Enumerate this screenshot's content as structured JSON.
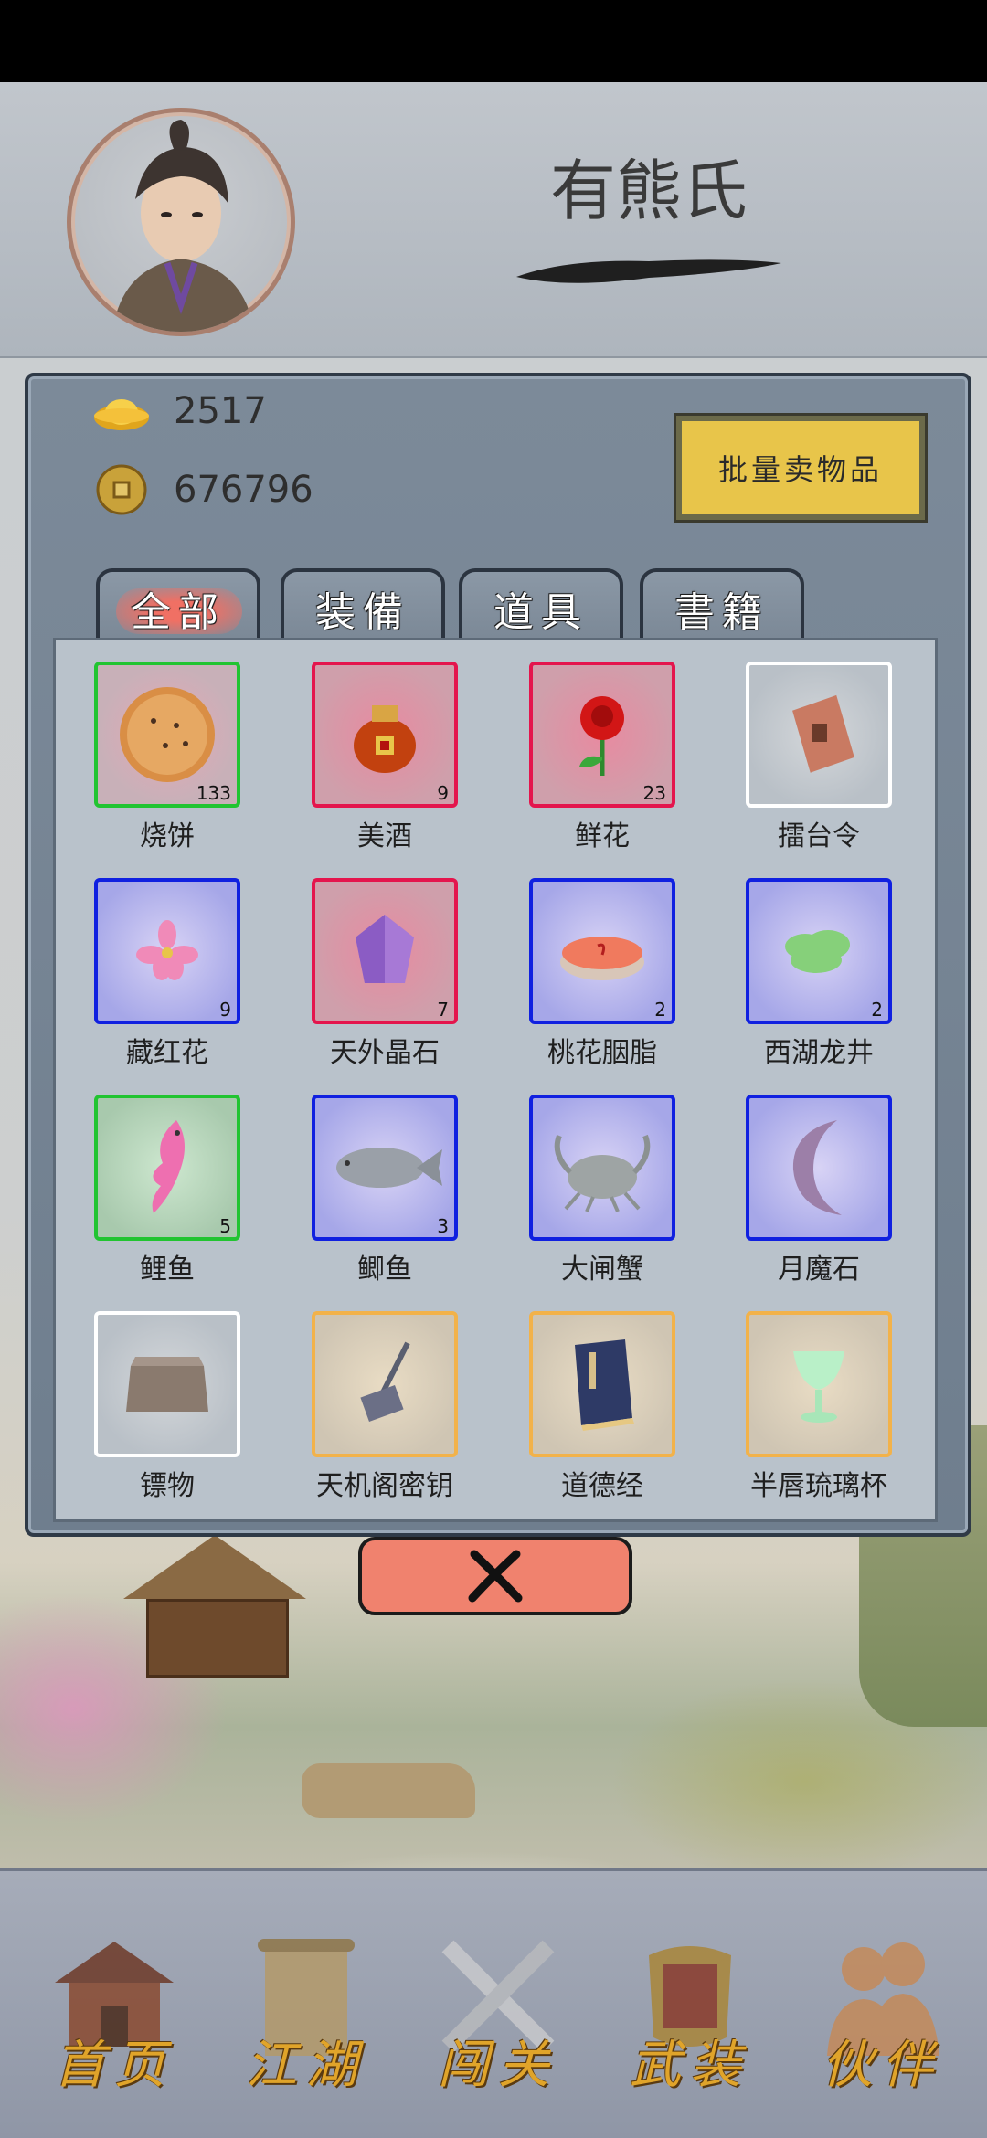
{
  "profile": {
    "name": "有熊氏"
  },
  "currency": {
    "gold_ingots": "2517",
    "coins": "676796"
  },
  "sell_button": "批量卖物品",
  "tabs": [
    {
      "label": "全部",
      "active": true
    },
    {
      "label": "装備",
      "active": false
    },
    {
      "label": "道具",
      "active": false
    },
    {
      "label": "書籍",
      "active": false
    }
  ],
  "items": [
    {
      "name": "烧饼",
      "count": "133",
      "rarity": "green",
      "icon": "flatbread-icon"
    },
    {
      "name": "美酒",
      "count": "9",
      "rarity": "red",
      "icon": "wine-jar-icon"
    },
    {
      "name": "鲜花",
      "count": "23",
      "rarity": "red",
      "icon": "rose-icon"
    },
    {
      "name": "擂台令",
      "count": "",
      "rarity": "white",
      "icon": "token-icon"
    },
    {
      "name": "藏红花",
      "count": "9",
      "rarity": "blue",
      "icon": "saffron-icon"
    },
    {
      "name": "天外晶石",
      "count": "7",
      "rarity": "red",
      "icon": "crystal-icon"
    },
    {
      "name": "桃花胭脂",
      "count": "2",
      "rarity": "blue",
      "icon": "rouge-icon"
    },
    {
      "name": "西湖龙井",
      "count": "2",
      "rarity": "blue",
      "icon": "tea-icon"
    },
    {
      "name": "鲤鱼",
      "count": "5",
      "rarity": "green2",
      "icon": "carp-icon"
    },
    {
      "name": "鲫鱼",
      "count": "3",
      "rarity": "blue",
      "icon": "crucian-fish-icon"
    },
    {
      "name": "大闸蟹",
      "count": "",
      "rarity": "blue",
      "icon": "crab-icon"
    },
    {
      "name": "月魔石",
      "count": "",
      "rarity": "blue",
      "icon": "moon-stone-icon"
    },
    {
      "name": "镖物",
      "count": "",
      "rarity": "white",
      "icon": "cargo-box-icon"
    },
    {
      "name": "天机阁密钥",
      "count": "",
      "rarity": "orange",
      "icon": "key-icon"
    },
    {
      "name": "道德经",
      "count": "",
      "rarity": "orange",
      "icon": "book-icon"
    },
    {
      "name": "半唇琉璃杯",
      "count": "",
      "rarity": "orange",
      "icon": "glass-cup-icon"
    }
  ],
  "nav": [
    {
      "label": "首页",
      "icon": "house-icon"
    },
    {
      "label": "江湖",
      "icon": "scroll-icon"
    },
    {
      "label": "闯关",
      "icon": "crossed-swords-icon"
    },
    {
      "label": "武装",
      "icon": "armor-icon"
    },
    {
      "label": "伙伴",
      "icon": "partners-icon"
    }
  ],
  "colors": {
    "rarity_green": "#21c431",
    "rarity_red": "#e4154d",
    "rarity_white": "#ffffff",
    "rarity_blue": "#1020e0",
    "rarity_orange": "#f2b24a",
    "accent_sell": "#e8c54a",
    "close": "#f0826e"
  }
}
